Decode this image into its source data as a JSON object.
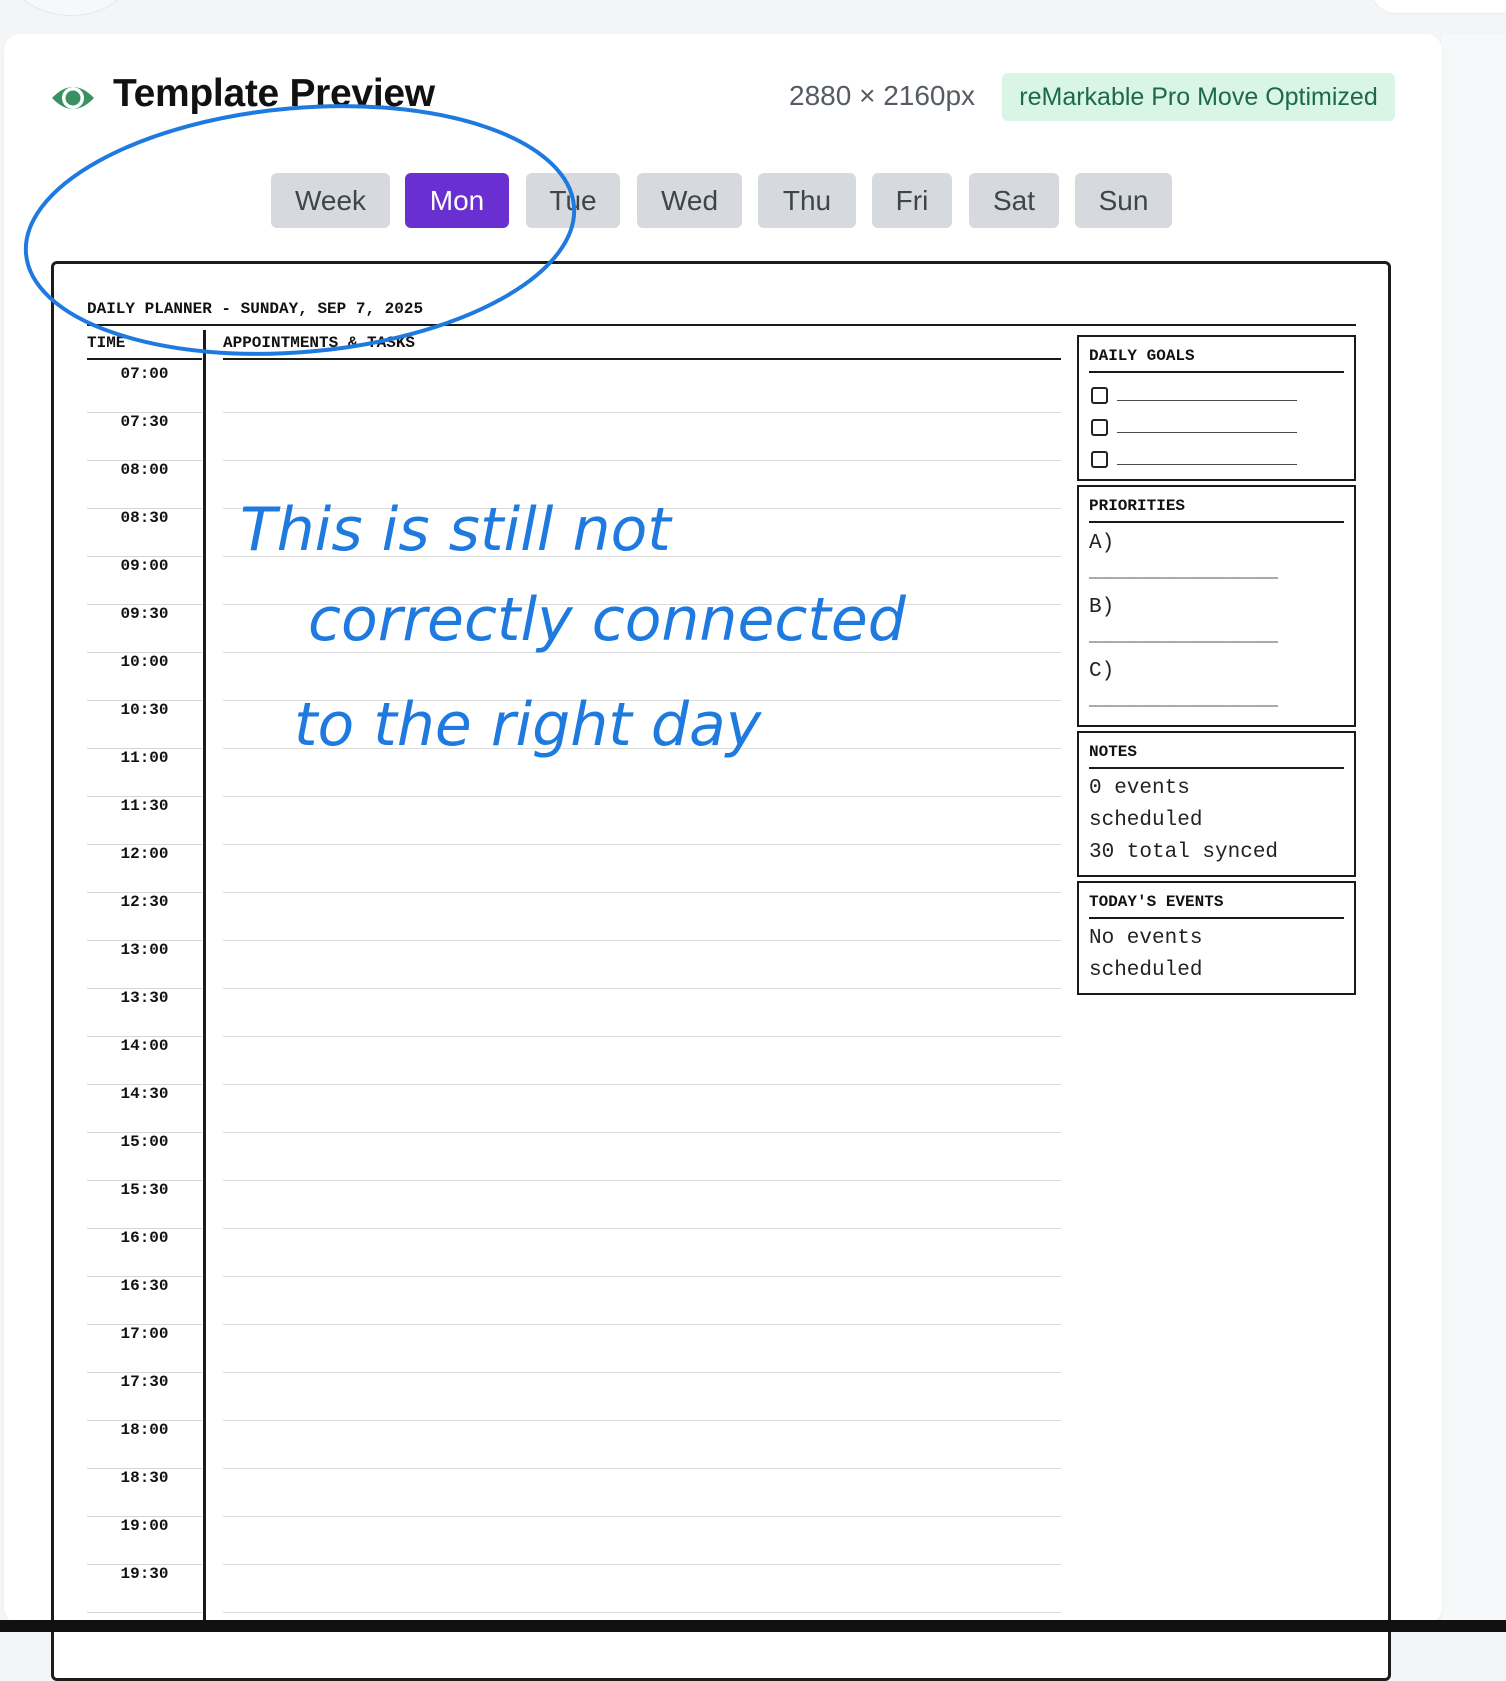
{
  "header": {
    "title": "Template Preview",
    "dimensions": "2880 × 2160px",
    "badge": "reMarkable Pro Move Optimized",
    "eye_icon": "eye-icon",
    "accent_color": "#3a8f63"
  },
  "tabs": [
    {
      "label": "Week",
      "active": false
    },
    {
      "label": "Mon",
      "active": true
    },
    {
      "label": "Tue",
      "active": false
    },
    {
      "label": "Wed",
      "active": false
    },
    {
      "label": "Thu",
      "active": false
    },
    {
      "label": "Fri",
      "active": false
    },
    {
      "label": "Sat",
      "active": false
    },
    {
      "label": "Sun",
      "active": false
    }
  ],
  "active_tab_color": "#6a2fd0",
  "planner": {
    "title": "DAILY PLANNER - SUNDAY, SEP 7, 2025",
    "time_header": "TIME",
    "appointments_header": "APPOINTMENTS & TASKS",
    "times": [
      "07:00",
      "07:30",
      "08:00",
      "08:30",
      "09:00",
      "09:30",
      "10:00",
      "10:30",
      "11:00",
      "11:30",
      "12:00",
      "12:30",
      "13:00",
      "13:30",
      "14:00",
      "14:30",
      "15:00",
      "15:30",
      "16:00",
      "16:30",
      "17:00",
      "17:30",
      "18:00",
      "18:30",
      "19:00",
      "19:30"
    ],
    "daily_goals": {
      "title": "DAILY GOALS",
      "items": [
        "_______________",
        "_______________",
        "_______________"
      ]
    },
    "priorities": {
      "title": "PRIORITIES",
      "items": [
        {
          "label": "A)",
          "line": "_______________"
        },
        {
          "label": "B)",
          "line": "_______________"
        },
        {
          "label": "C)",
          "line": "_______________"
        }
      ]
    },
    "notes": {
      "title": "NOTES",
      "lines": [
        "0 events",
        "scheduled",
        "30 total synced"
      ]
    },
    "todays_events": {
      "title": "TODAY'S EVENTS",
      "lines": [
        "No events",
        "scheduled"
      ]
    }
  },
  "annotation": {
    "handwriting": [
      "This is still not",
      "correctly connected",
      "to the right day"
    ],
    "ink_color": "#1f7ae0"
  }
}
